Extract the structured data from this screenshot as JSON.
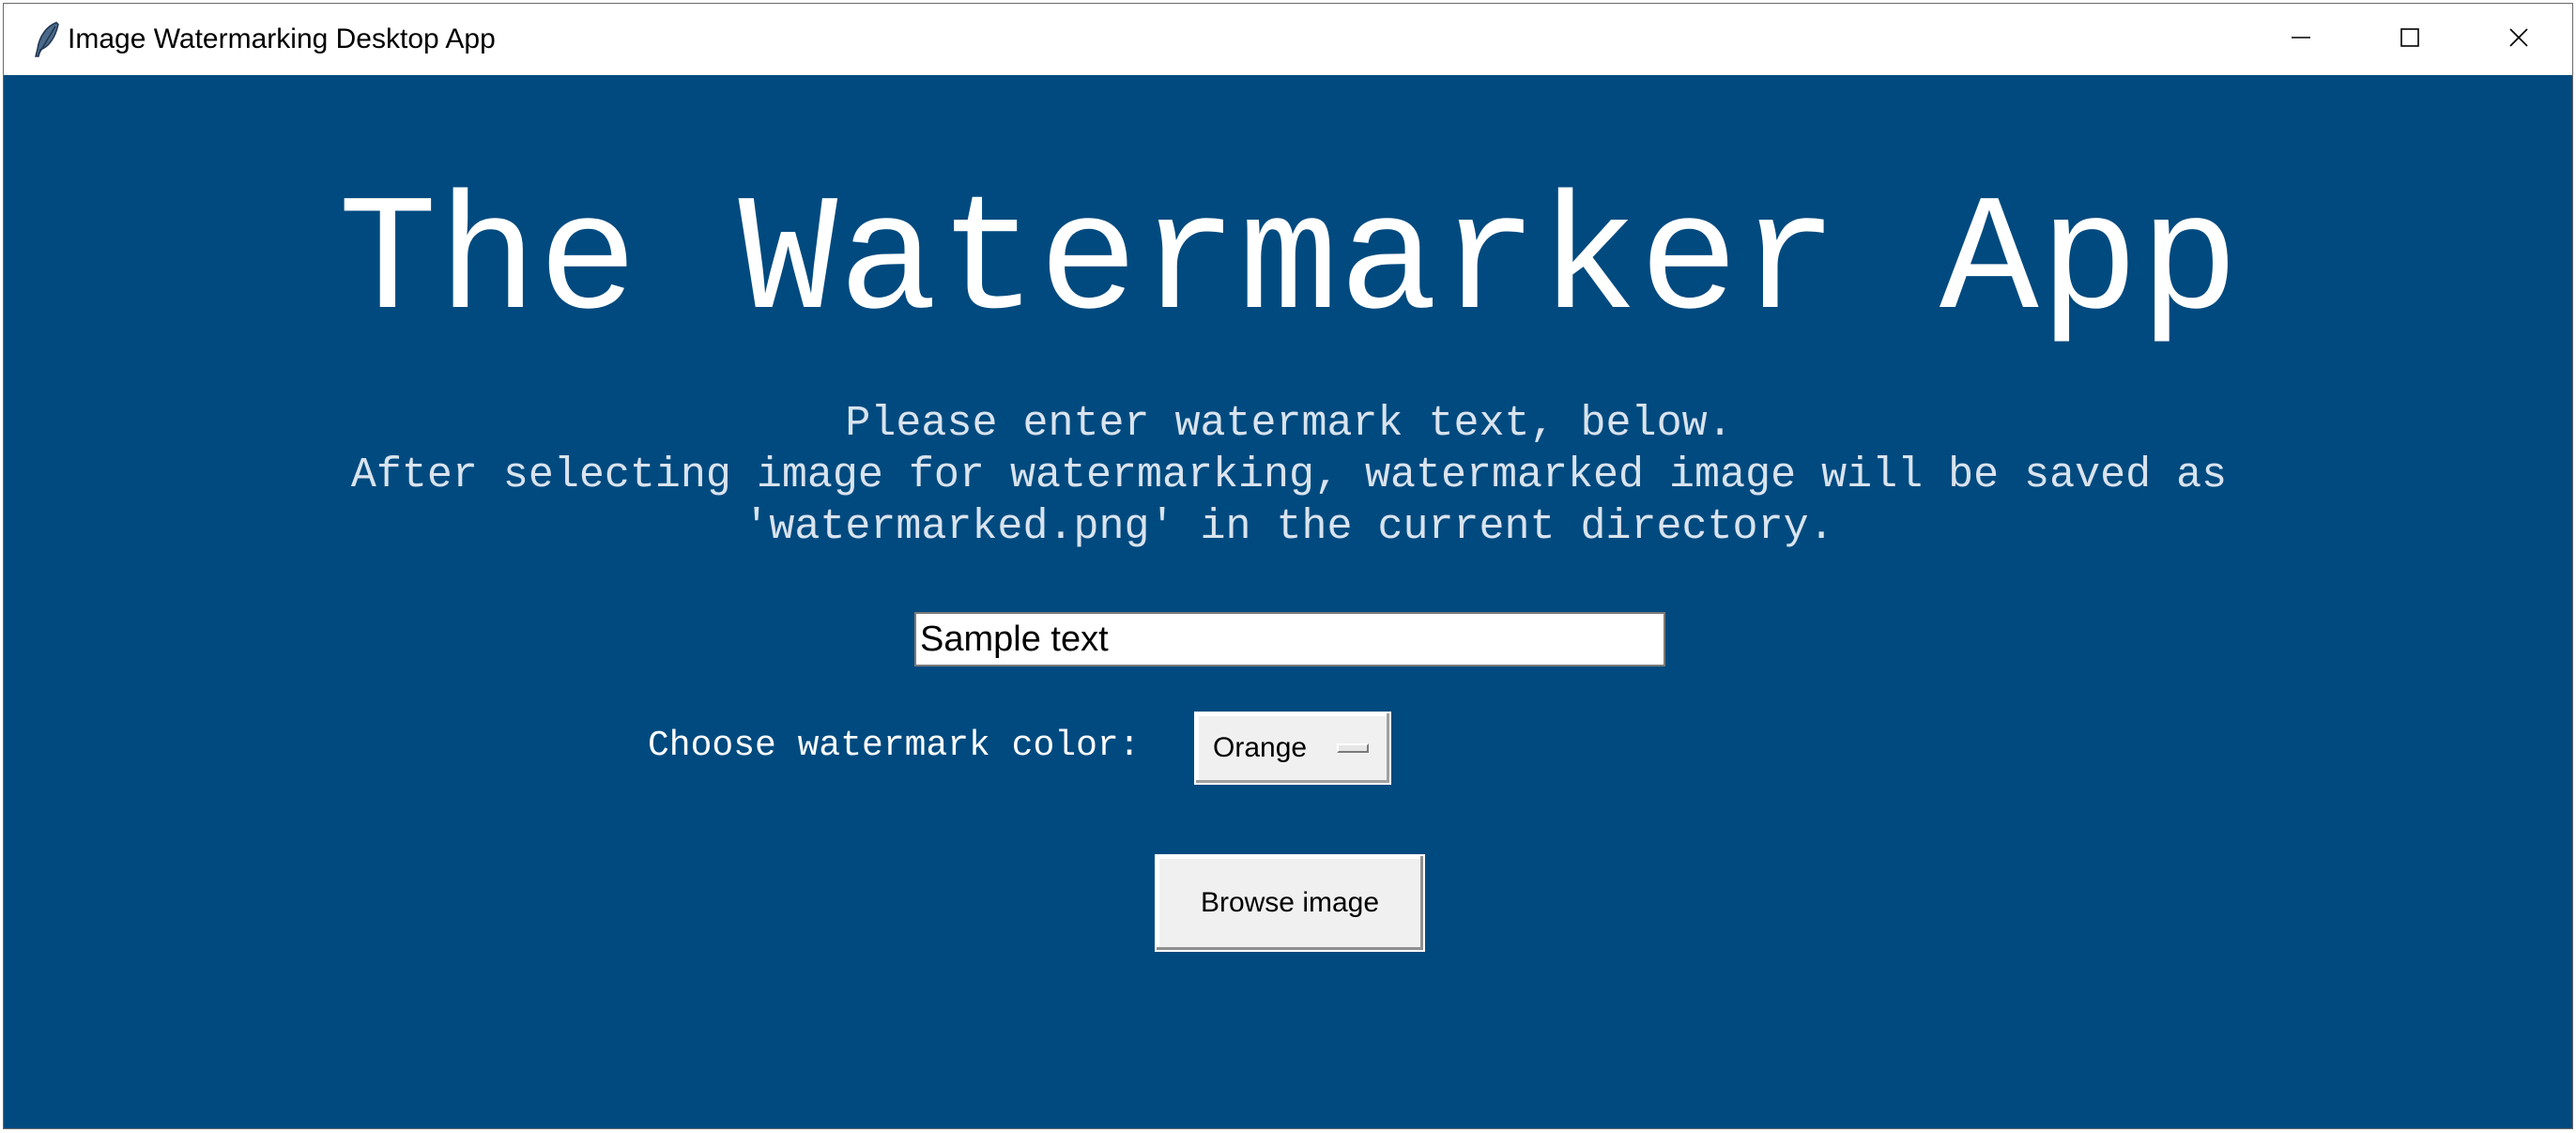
{
  "window": {
    "title": "Image Watermarking Desktop App",
    "icons": {
      "app": "feather-icon",
      "minimize": "minimize-icon",
      "maximize": "maximize-icon",
      "close": "close-icon"
    }
  },
  "main": {
    "heading": "The Watermarker App",
    "instructions": [
      "Please enter watermark text, below.",
      "After selecting image for watermarking, watermarked image will be saved as",
      "'watermarked.png' in the current directory."
    ],
    "watermark_text_value": "Sample text",
    "color_label": "Choose watermark color:",
    "color_selected": "Orange",
    "browse_button_label": "Browse image"
  },
  "colors": {
    "background": "#004a7f",
    "heading_text": "#ffffff",
    "instruction_text": "#d9e3ee"
  }
}
